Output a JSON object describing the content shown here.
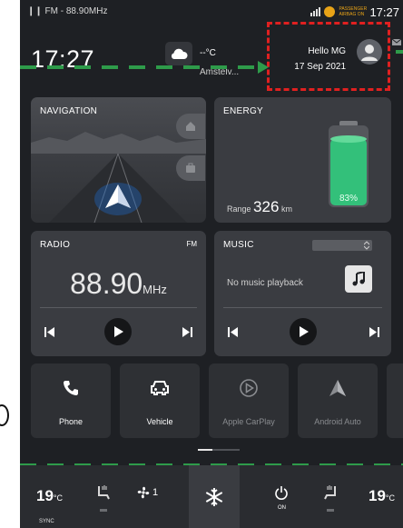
{
  "status_bar": {
    "radio_info": "FM - 88.90MHz",
    "airbag_notice": "PASSENGER AIRBAG ON",
    "time": "17:27"
  },
  "header": {
    "clock": "17:27",
    "weather": {
      "temperature": "--°C",
      "location": "Amstelv...",
      "icon": "cloud-icon"
    },
    "profile": {
      "greeting": "Hello MG",
      "date": "17 Sep 2021",
      "icon": "avatar-icon"
    }
  },
  "cards": {
    "navigation": {
      "title": "NAVIGATION"
    },
    "energy": {
      "title": "ENERGY",
      "range_label": "Range",
      "range_value": "326",
      "range_unit": "km",
      "battery_percent": "83%",
      "battery_level": 0.83
    },
    "radio": {
      "title": "RADIO",
      "band": "FM",
      "frequency": "88.90",
      "unit": "MHz"
    },
    "music": {
      "title": "MUSIC",
      "status": "No music playback"
    }
  },
  "shortcuts": [
    {
      "label": "Phone",
      "icon": "phone-icon",
      "enabled": true
    },
    {
      "label": "Vehicle",
      "icon": "car-icon",
      "enabled": true
    },
    {
      "label": "Apple CarPlay",
      "icon": "carplay-icon",
      "enabled": false
    },
    {
      "label": "Android Auto",
      "icon": "android-auto-icon",
      "enabled": false
    }
  ],
  "climate": {
    "driver_temp": "19",
    "passenger_temp": "19",
    "temp_unit": "°C",
    "sync_label": "SYNC",
    "fan_level": "1",
    "ac_state": "ON"
  },
  "colors": {
    "background": "#1e2024",
    "card": "#3a3c41",
    "battery_green": "#33c07a",
    "highlight_red": "#e02020",
    "guide_green": "#2e9b4a"
  }
}
